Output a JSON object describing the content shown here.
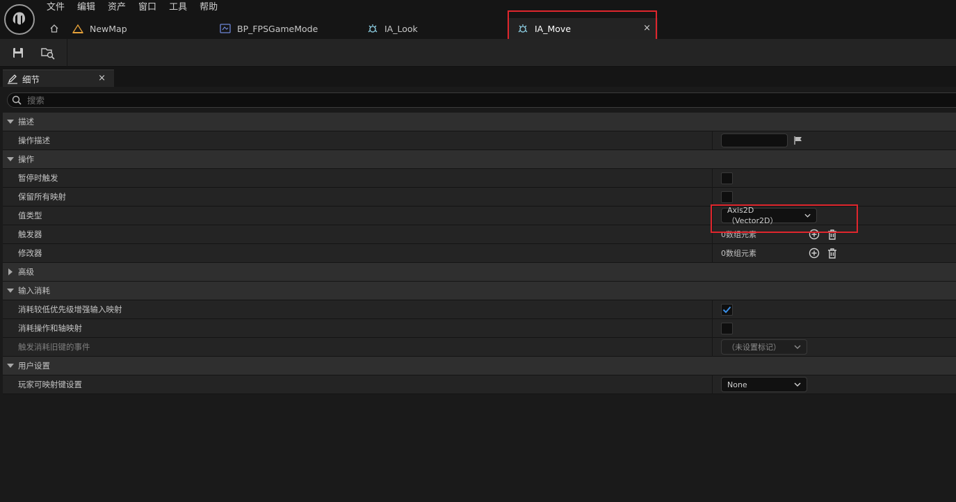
{
  "menu": [
    "文件",
    "编辑",
    "资产",
    "窗口",
    "工具",
    "帮助"
  ],
  "tabs": {
    "newmap": "NewMap",
    "gamemode": "BP_FPSGameMode",
    "look": "IA_Look",
    "move": "IA_Move",
    "close": "×"
  },
  "panel": {
    "title": "细节",
    "close": "×",
    "search_placeholder": "搜索"
  },
  "sections": {
    "describe": {
      "label": "描述",
      "action_description": "操作描述"
    },
    "action": {
      "label": "操作",
      "trigger_when_paused": "暂停时触发",
      "reserve_all_mappings": "保留所有映射",
      "value_type": "值类型",
      "value_type_value": "Axis2D（Vector2D）",
      "triggers": "触发器",
      "triggers_value": "0数组元素",
      "modifiers": "修改器",
      "modifiers_value": "0数组元素"
    },
    "advanced": {
      "label": "高级"
    },
    "input_consumption": {
      "label": "输入消耗",
      "consume_lower_priority": "消耗较低优先级增强输入映射",
      "consume_lower_priority_checked": true,
      "consume_action_axis": "消耗操作和轴映射",
      "consume_action_axis_checked": false,
      "trigger_legacy_events": "触发消耗旧键的事件",
      "trigger_legacy_events_value": "（未设置标记）"
    },
    "user_settings": {
      "label": "用户设置",
      "player_mappable": "玩家可映射键设置",
      "player_mappable_value": "None"
    }
  },
  "colors": {
    "accent_checkbox": "#3a8ee6",
    "highlight": "#e0262d"
  }
}
